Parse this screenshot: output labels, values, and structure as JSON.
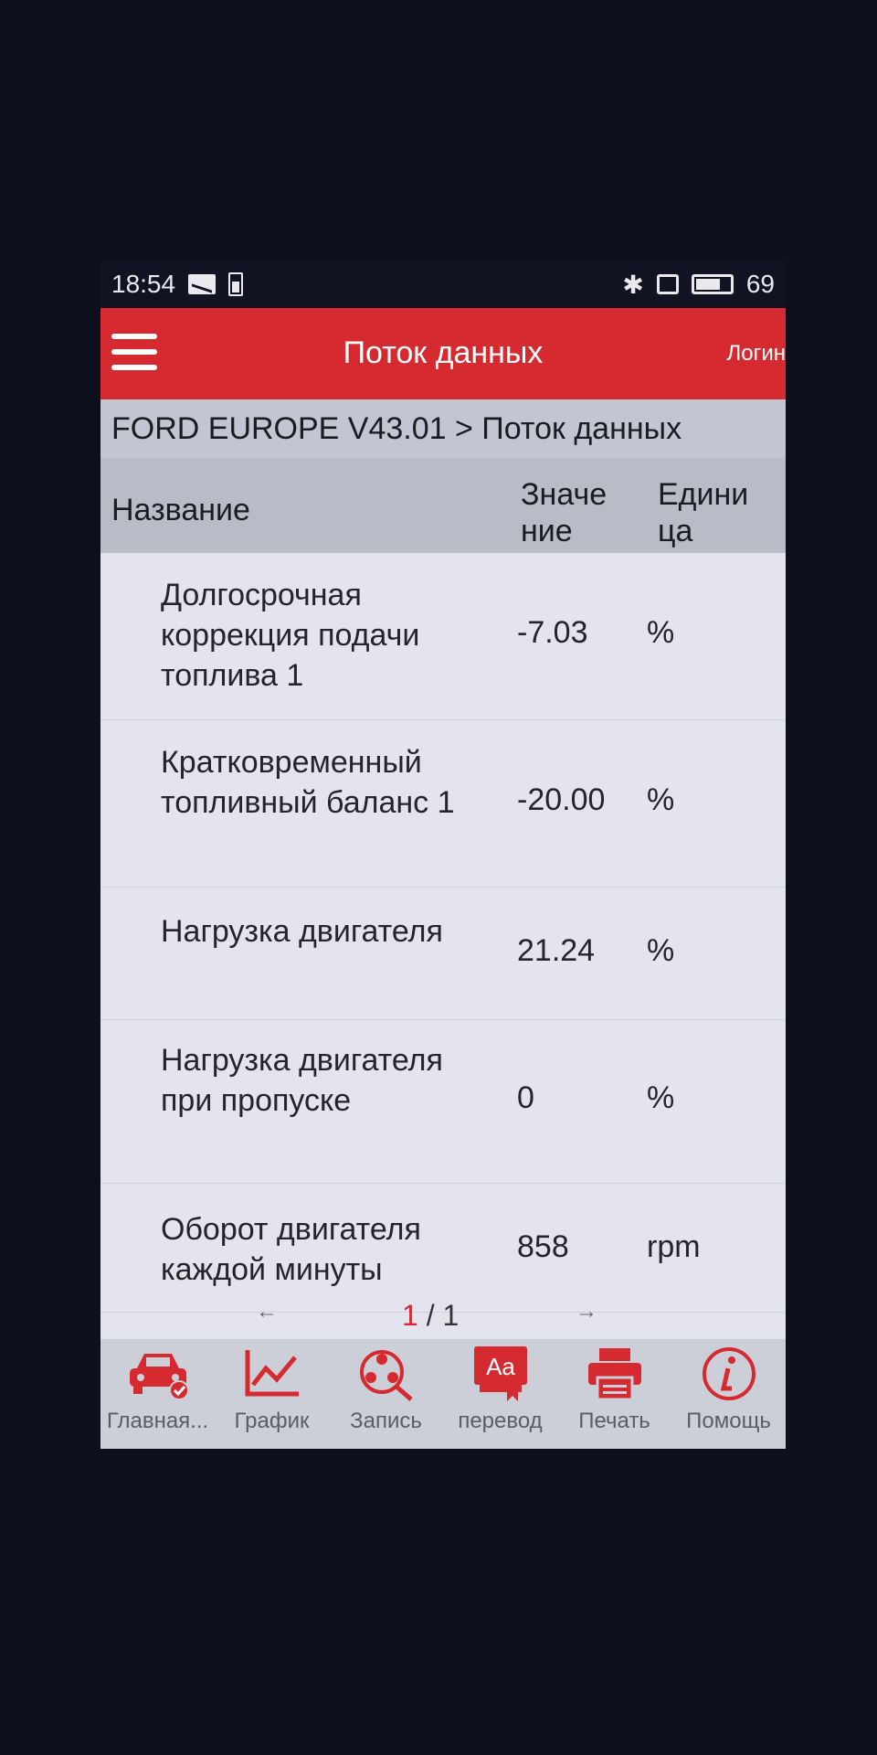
{
  "statusbar": {
    "time": "18:54",
    "battery": "69"
  },
  "appbar": {
    "title": "Поток данных",
    "login": "Логин"
  },
  "breadcrumb": "FORD EUROPE V43.01 > Поток данных",
  "table": {
    "headers": {
      "name": "Название",
      "value": "Значение",
      "unit": "Единица"
    },
    "rows": [
      {
        "name": "Долгосрочная коррекция подачи топлива 1",
        "value": "-7.03",
        "unit": "%"
      },
      {
        "name": "Кратковременный топливный баланс 1",
        "value": "-20.00",
        "unit": "%"
      },
      {
        "name": "Нагрузка двигателя",
        "value": "21.24",
        "unit": "%"
      },
      {
        "name": "Нагрузка двигателя при пропуске",
        "value": "0",
        "unit": "%"
      },
      {
        "name": "Оборот двигателя каждой минуты",
        "value": "858",
        "unit": "rpm"
      }
    ]
  },
  "pager": {
    "prev": "←",
    "current": "1",
    "separator": " / ",
    "total": "1",
    "next": "→"
  },
  "toolbar": {
    "accent": "#d42a30",
    "items": [
      {
        "label": "Главная...",
        "icon": "car-icon"
      },
      {
        "label": "График",
        "icon": "graph-icon"
      },
      {
        "label": "Запись",
        "icon": "film-reel-icon"
      },
      {
        "label": "перевод",
        "icon": "translate-icon",
        "badge": "Aa"
      },
      {
        "label": "Печать",
        "icon": "printer-icon"
      },
      {
        "label": "Помощь",
        "icon": "info-icon"
      }
    ]
  }
}
